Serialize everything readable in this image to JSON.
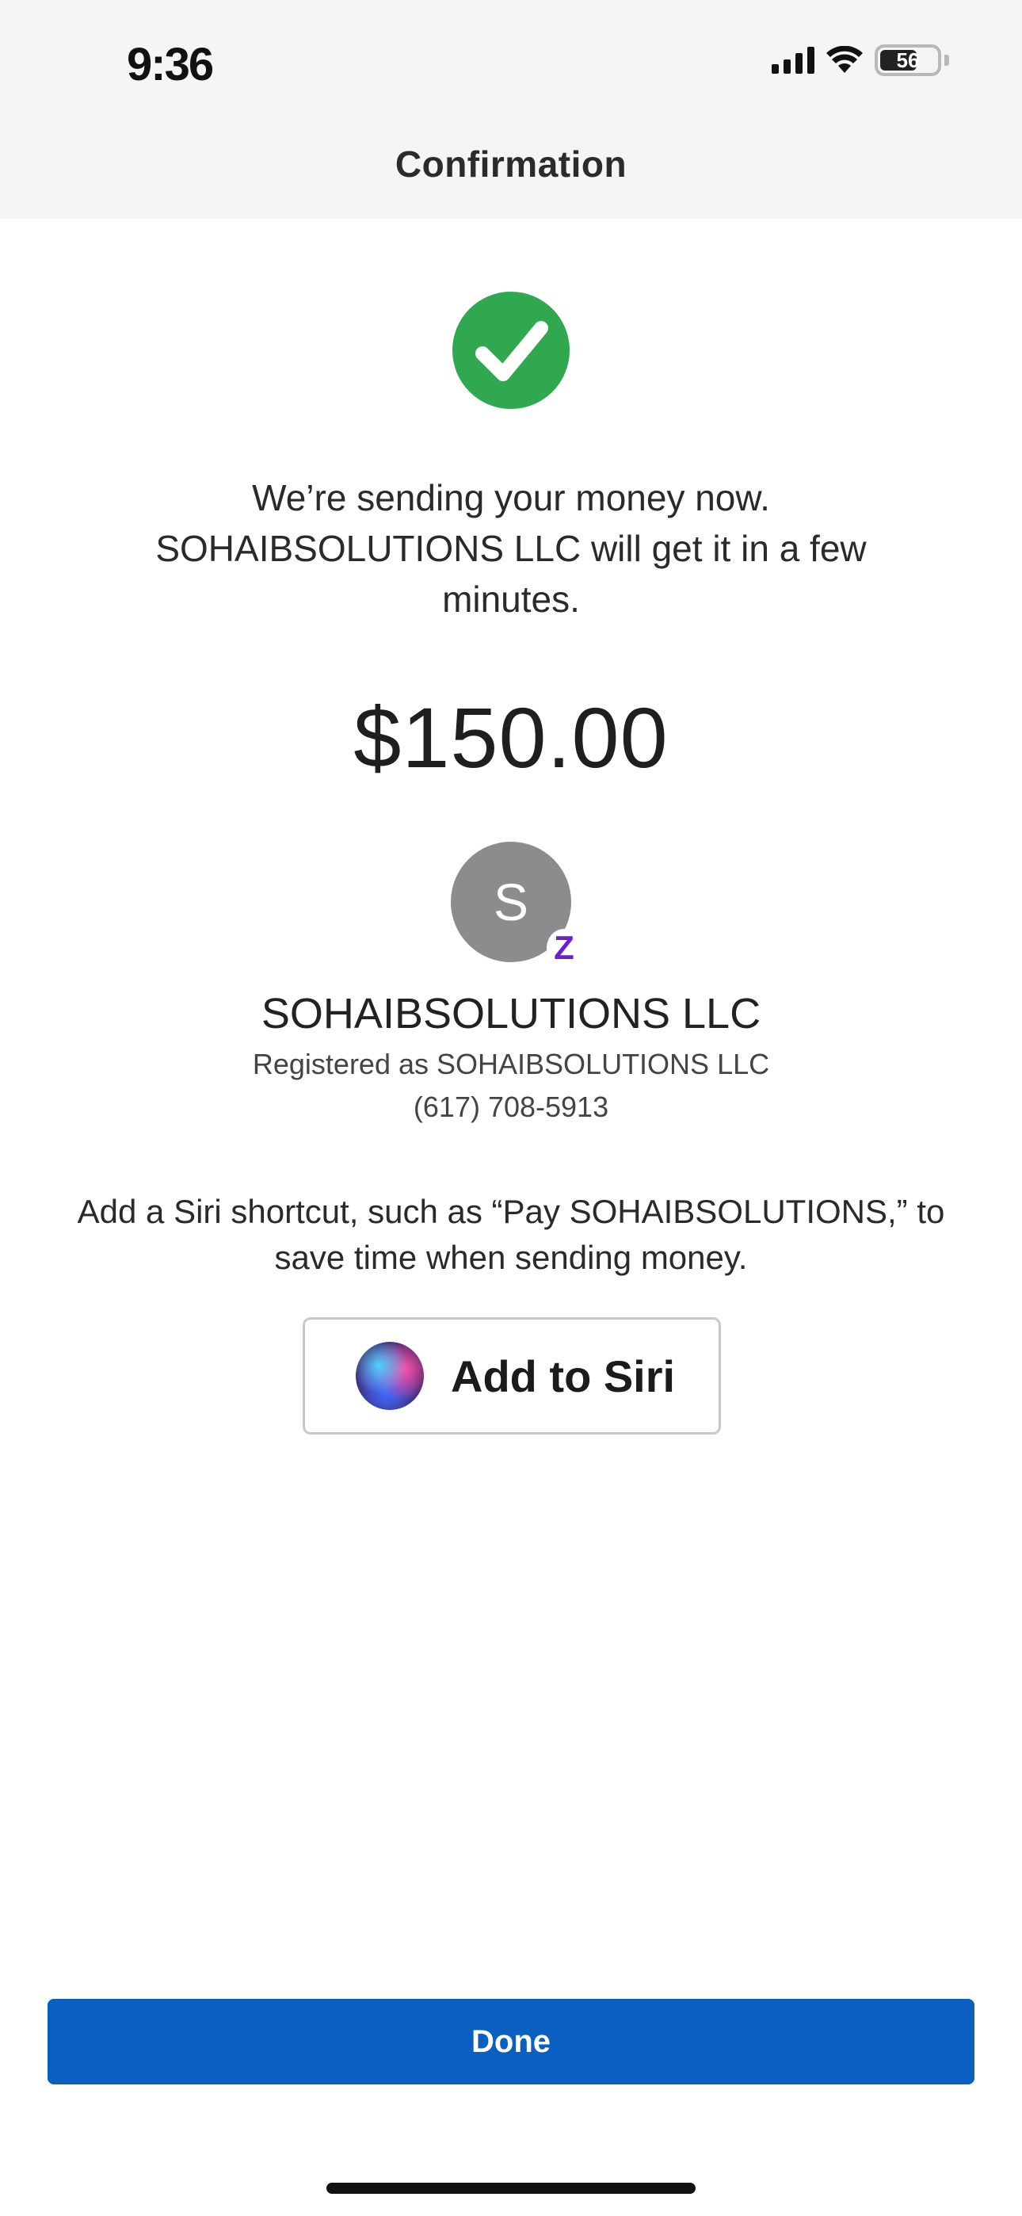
{
  "status_bar": {
    "time": "9:36",
    "battery_level": "56",
    "icons": [
      "cellular-signal-icon",
      "wifi-icon",
      "battery-icon"
    ]
  },
  "nav": {
    "title": "Confirmation"
  },
  "success": {
    "icon": "checkmark-icon",
    "color": "#2fa84f",
    "message": "We’re sending your money now. SOHAIBSOLUTIONS LLC will get it in a few minutes."
  },
  "payment": {
    "amount": "$150.00"
  },
  "recipient": {
    "avatar_initial": "S",
    "avatar_color": "#8c8c8c",
    "badge": "Z",
    "name": "SOHAIBSOLUTIONS LLC",
    "registered": "Registered as SOHAIBSOLUTIONS LLC",
    "phone": "(617) 708-5913"
  },
  "siri": {
    "hint": "Add a Siri shortcut, such as “Pay SOHAIBSOLUTIONS,” to save time when sending money.",
    "button_label": "Add to Siri",
    "icon": "siri-icon"
  },
  "actions": {
    "done_label": "Done",
    "done_color": "#0a5fc0"
  }
}
